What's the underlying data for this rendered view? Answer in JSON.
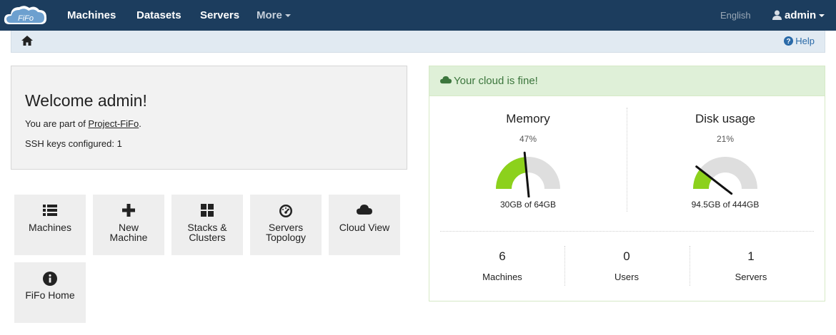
{
  "nav": {
    "logo_text": "FiFo",
    "items": [
      {
        "label": "Machines"
      },
      {
        "label": "Datasets"
      },
      {
        "label": "Servers"
      },
      {
        "label": "More"
      }
    ],
    "language": "English",
    "user": "admin"
  },
  "breadcrumb": {
    "help_label": "Help"
  },
  "welcome": {
    "title": "Welcome admin!",
    "part_of_prefix": "You are part of ",
    "org_link": "Project-FiFo",
    "part_of_suffix": ".",
    "ssh_keys": "SSH keys configured: 1"
  },
  "tiles": [
    {
      "line1": "Machines",
      "line2": "",
      "icon": "list-icon"
    },
    {
      "line1": "New",
      "line2": "Machine",
      "icon": "plus-icon"
    },
    {
      "line1": "Stacks &",
      "line2": "Clusters",
      "icon": "grid-icon"
    },
    {
      "line1": "Servers",
      "line2": "Topology",
      "icon": "dashboard-icon"
    },
    {
      "line1": "Cloud View",
      "line2": "",
      "icon": "cloud-icon"
    },
    {
      "line1": "FiFo Home",
      "line2": "",
      "icon": "info-icon"
    }
  ],
  "status": {
    "message": "Your cloud is fine!",
    "memory": {
      "title": "Memory",
      "percent_label": "47%",
      "percent": 47,
      "caption": "30GB of 64GB"
    },
    "disk": {
      "title": "Disk usage",
      "percent_label": "21%",
      "percent": 21,
      "caption": "94.5GB of 444GB"
    },
    "stats": [
      {
        "value": "6",
        "label": "Machines"
      },
      {
        "value": "0",
        "label": "Users"
      },
      {
        "value": "1",
        "label": "Servers"
      }
    ]
  },
  "colors": {
    "navbar": "#1c3d5e",
    "gauge_fill": "#8cd11c",
    "gauge_track": "#dedede",
    "status_ok": "#3c763d"
  }
}
